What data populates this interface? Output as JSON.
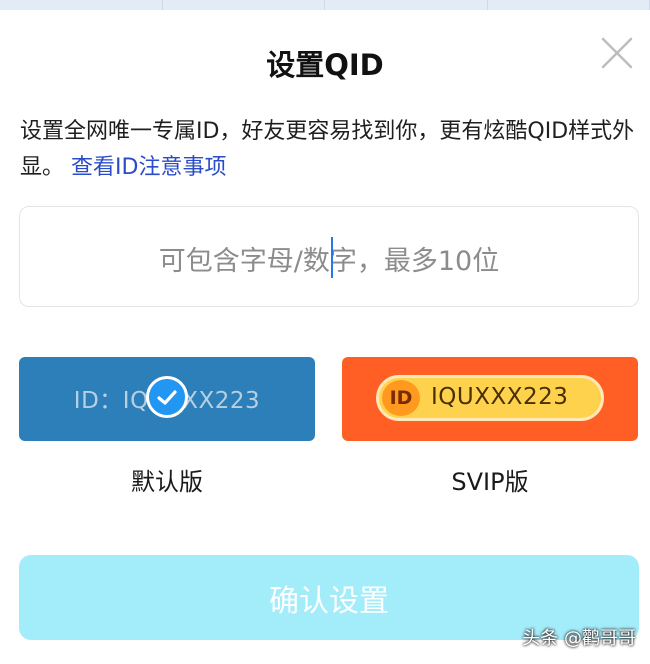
{
  "dialog": {
    "title": "设置QID",
    "close_icon": "close-icon"
  },
  "description": {
    "text": "设置全网唯一专属ID，好友更容易找到你，更有炫酷QID样式外显。",
    "link": "查看ID注意事项"
  },
  "id_input": {
    "placeholder": "可包含字母/数字，最多10位",
    "value": ""
  },
  "styles": {
    "default": {
      "preview": "ID：IQUXXX223",
      "label": "默认版",
      "selected": true,
      "check_icon": "check-circle-icon"
    },
    "svip": {
      "logo": "ID",
      "preview": "IQUXXX223",
      "label": "SVIP版",
      "selected": false
    }
  },
  "confirm_button": {
    "label": "确认设置",
    "enabled": false
  },
  "watermark": "头条 @鹳哥哥",
  "colors": {
    "link": "#2b4cc9",
    "default_card": "#2c7fb8",
    "svip_card": "#ff5f24",
    "svip_pill": "#ffd24d",
    "check_badge": "#2196f3",
    "confirm_disabled": "#a3ecfa",
    "caret": "#2a78e4"
  }
}
